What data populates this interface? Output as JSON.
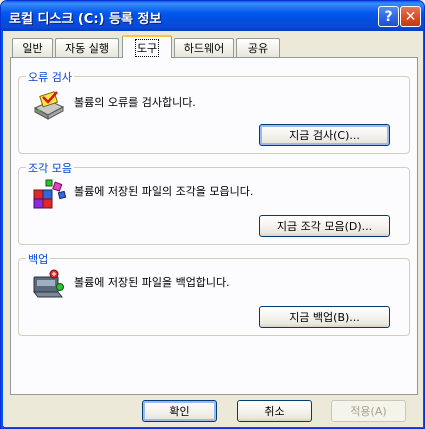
{
  "window": {
    "title": "로컬 디스크 (C:) 등록 정보"
  },
  "titlebar": {
    "help_label": "?",
    "close_label": "✕"
  },
  "tabs": [
    {
      "label": "일반"
    },
    {
      "label": "자동 실행"
    },
    {
      "label": "도구",
      "active": true
    },
    {
      "label": "하드웨어"
    },
    {
      "label": "공유"
    }
  ],
  "groups": {
    "error_check": {
      "title": "오류 검사",
      "description": "볼륨의 오류를 검사합니다.",
      "button_label": "지금 검사(C)...",
      "icon": "disk-check-icon"
    },
    "defrag": {
      "title": "조각 모음",
      "description": "볼륨에 저장된 파일의 조각을 모읍니다.",
      "button_label": "지금 조각 모음(D)...",
      "icon": "defrag-icon"
    },
    "backup": {
      "title": "백업",
      "description": "볼륨에 저장된 파일을 백업합니다.",
      "button_label": "지금 백업(B)...",
      "icon": "backup-icon"
    }
  },
  "footer": {
    "ok_label": "확인",
    "cancel_label": "취소",
    "apply_label": "적용(A)"
  },
  "colors": {
    "titlebar": "#0058ee",
    "group_title": "#0046d5",
    "active_tab_accent": "#ffc83c",
    "close_button": "#d64a24"
  }
}
